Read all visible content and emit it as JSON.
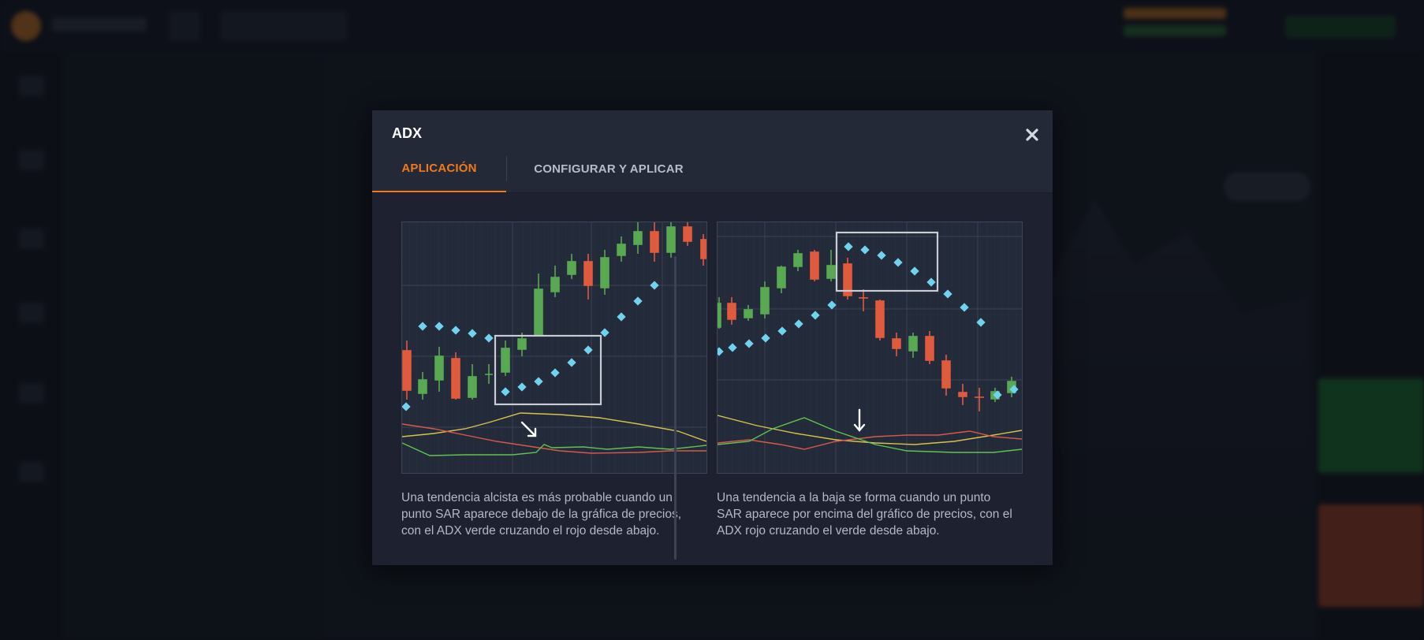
{
  "modal": {
    "title": "ADX",
    "tabs": [
      {
        "label": "APLICACIÓN",
        "active": true
      },
      {
        "label": "CONFIGURAR Y APLICAR",
        "active": false
      }
    ],
    "cards": [
      {
        "caption": "Una tendencia alcista es más probable cuando un punto SAR aparece debajo de la gráfica de precios, con el ADX verde cruzando el rojo desde abajo.",
        "illustration": "uptrend-sar-adx"
      },
      {
        "caption": "Una tendencia a la baja se forma cuando un punto SAR aparece por encima del gráfico de precios, con el ADX rojo cruzando el verde desde abajo.",
        "illustration": "downtrend-sar-adx"
      }
    ]
  },
  "colors": {
    "accent": "#ef7a1e",
    "bull_candle": "#59a852",
    "bear_candle": "#e05a3e",
    "sar_dot": "#6fd3ee",
    "adx_yellow": "#d8c24a",
    "adx_red": "#d8584a",
    "adx_green": "#5fc44f"
  },
  "icons": {
    "close": "close-icon",
    "arrow_left_card": "arrow-down-right-icon",
    "arrow_right_card": "arrow-down-icon"
  }
}
